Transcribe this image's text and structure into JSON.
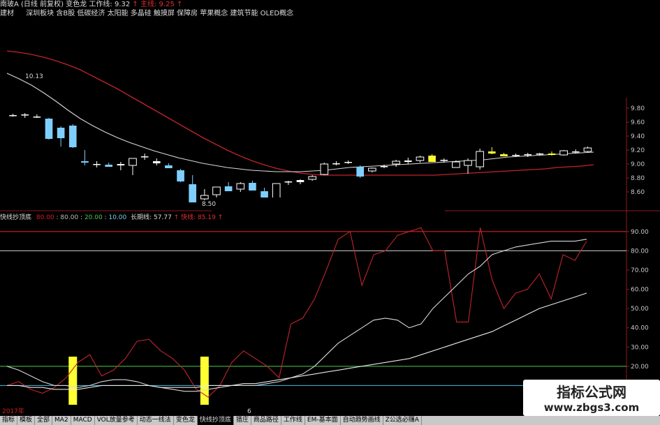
{
  "header": {
    "stock": "南玻A",
    "mode": "(日线 前复权)",
    "indicator": "变色龙",
    "work_line_label": "工作线:",
    "work_line_value": "9.32",
    "main_line_label": "主线:",
    "main_line_value": "9.25",
    "sector": "建材",
    "concepts": "深圳板块  含B股 低碳经济 太阳能 多晶硅 触摸屏 保障房 苹果概念 建筑节能 OLED概念"
  },
  "lower_header": {
    "name": "快线抄顶底",
    "ref_lines": [
      "80.00",
      "80.00",
      "20.00",
      "10.00"
    ],
    "long_label": "长期线:",
    "long_value": "57.77",
    "fast_label": "快线:",
    "fast_value": "85.19"
  },
  "annotations": {
    "high": "10.13",
    "low": "8.50"
  },
  "x_axis": {
    "labels": [
      "2017年",
      "6"
    ]
  },
  "colors": {
    "bg": "#000000",
    "up": "#ffffff",
    "down": "#7ecfff",
    "flat_yellow": "#ffff33",
    "ma_fast": "#d8d8d8",
    "ma_slow": "#c0242c",
    "red_line": "#d21f26",
    "grid": "#8c1a1a"
  },
  "chart_data": [
    {
      "type": "candlestick",
      "ylim": [
        8.5,
        9.9
      ],
      "y_ticks": [
        "9.80",
        "9.60",
        "9.40",
        "9.20",
        "9.00",
        "8.80",
        "8.60"
      ],
      "candles": [
        {
          "o": 9.7,
          "h": 9.72,
          "l": 9.68,
          "c": 9.7,
          "col": "up"
        },
        {
          "o": 9.7,
          "h": 9.73,
          "l": 9.66,
          "c": 9.71,
          "col": "up"
        },
        {
          "o": 9.68,
          "h": 9.71,
          "l": 9.66,
          "c": 9.68,
          "col": "up"
        },
        {
          "o": 9.65,
          "h": 9.66,
          "l": 9.35,
          "c": 9.36,
          "col": "down"
        },
        {
          "o": 9.52,
          "h": 9.54,
          "l": 9.25,
          "c": 9.37,
          "col": "down"
        },
        {
          "o": 9.55,
          "h": 9.57,
          "l": 9.23,
          "c": 9.24,
          "col": "down"
        },
        {
          "o": 9.04,
          "h": 9.2,
          "l": 8.98,
          "c": 9.02,
          "col": "down"
        },
        {
          "o": 9.0,
          "h": 9.04,
          "l": 8.95,
          "c": 8.99,
          "col": "up"
        },
        {
          "o": 8.99,
          "h": 9.02,
          "l": 8.96,
          "c": 8.96,
          "col": "down"
        },
        {
          "o": 8.98,
          "h": 9.03,
          "l": 8.91,
          "c": 9.0,
          "col": "up"
        },
        {
          "o": 8.98,
          "h": 9.06,
          "l": 8.84,
          "c": 9.08,
          "col": "up"
        },
        {
          "o": 9.11,
          "h": 9.15,
          "l": 9.06,
          "c": 9.1,
          "col": "up"
        },
        {
          "o": 9.01,
          "h": 9.08,
          "l": 8.98,
          "c": 9.04,
          "col": "up"
        },
        {
          "o": 8.98,
          "h": 9.01,
          "l": 8.94,
          "c": 8.94,
          "col": "down"
        },
        {
          "o": 8.91,
          "h": 8.93,
          "l": 8.74,
          "c": 8.75,
          "col": "down"
        },
        {
          "o": 8.71,
          "h": 8.84,
          "l": 8.68,
          "c": 8.45,
          "col": "down"
        },
        {
          "o": 8.5,
          "h": 8.64,
          "l": 8.48,
          "c": 8.55,
          "col": "up"
        },
        {
          "o": 8.56,
          "h": 8.66,
          "l": 8.5,
          "c": 8.67,
          "col": "up"
        },
        {
          "o": 8.68,
          "h": 8.74,
          "l": 8.63,
          "c": 8.61,
          "col": "down"
        },
        {
          "o": 8.64,
          "h": 8.74,
          "l": 8.6,
          "c": 8.72,
          "col": "up"
        },
        {
          "o": 8.73,
          "h": 8.76,
          "l": 8.62,
          "c": 8.62,
          "col": "down"
        },
        {
          "o": 8.61,
          "h": 8.66,
          "l": 8.4,
          "c": 8.4,
          "col": "down"
        },
        {
          "o": 8.39,
          "h": 8.72,
          "l": 8.36,
          "c": 8.72,
          "col": "up"
        },
        {
          "o": 8.74,
          "h": 8.76,
          "l": 8.7,
          "c": 8.75,
          "col": "up"
        },
        {
          "o": 8.74,
          "h": 8.78,
          "l": 8.71,
          "c": 8.77,
          "col": "up"
        },
        {
          "o": 8.78,
          "h": 8.84,
          "l": 8.76,
          "c": 8.82,
          "col": "up"
        },
        {
          "o": 8.85,
          "h": 9.02,
          "l": 8.84,
          "c": 9.0,
          "col": "up"
        },
        {
          "o": 9.0,
          "h": 9.04,
          "l": 8.98,
          "c": 9.01,
          "col": "up"
        },
        {
          "o": 9.02,
          "h": 9.05,
          "l": 9.0,
          "c": 9.03,
          "col": "up"
        },
        {
          "o": 8.96,
          "h": 8.98,
          "l": 8.8,
          "c": 8.82,
          "col": "down"
        },
        {
          "o": 8.9,
          "h": 8.95,
          "l": 8.88,
          "c": 8.94,
          "col": "up"
        },
        {
          "o": 8.96,
          "h": 8.99,
          "l": 8.94,
          "c": 8.97,
          "col": "up"
        },
        {
          "o": 9.0,
          "h": 9.06,
          "l": 8.96,
          "c": 9.04,
          "col": "up"
        },
        {
          "o": 9.03,
          "h": 9.09,
          "l": 9.0,
          "c": 9.05,
          "col": "up"
        },
        {
          "o": 9.05,
          "h": 9.12,
          "l": 9.02,
          "c": 9.1,
          "col": "up"
        },
        {
          "o": 9.12,
          "h": 9.14,
          "l": 9.03,
          "c": 9.03,
          "col": "flat_yellow"
        },
        {
          "o": 9.06,
          "h": 9.08,
          "l": 9.02,
          "c": 9.05,
          "col": "up"
        },
        {
          "o": 9.03,
          "h": 9.05,
          "l": 8.95,
          "c": 8.95,
          "col": "up"
        },
        {
          "o": 9.05,
          "h": 9.08,
          "l": 8.86,
          "c": 8.98,
          "col": "up"
        },
        {
          "o": 8.96,
          "h": 9.22,
          "l": 8.92,
          "c": 9.18,
          "col": "up"
        },
        {
          "o": 9.18,
          "h": 9.24,
          "l": 9.14,
          "c": 9.15,
          "col": "flat_yellow"
        },
        {
          "o": 9.14,
          "h": 9.16,
          "l": 9.11,
          "c": 9.11,
          "col": "flat_yellow"
        },
        {
          "o": 9.12,
          "h": 9.15,
          "l": 9.1,
          "c": 9.13,
          "col": "up"
        },
        {
          "o": 9.13,
          "h": 9.16,
          "l": 9.1,
          "c": 9.14,
          "col": "up"
        },
        {
          "o": 9.14,
          "h": 9.16,
          "l": 9.12,
          "c": 9.15,
          "col": "up"
        },
        {
          "o": 9.15,
          "h": 9.18,
          "l": 9.12,
          "c": 9.13,
          "col": "flat_yellow"
        },
        {
          "o": 9.13,
          "h": 9.2,
          "l": 9.12,
          "c": 9.19,
          "col": "up"
        },
        {
          "o": 9.17,
          "h": 9.21,
          "l": 9.15,
          "c": 9.18,
          "col": "up"
        },
        {
          "o": 9.18,
          "h": 9.25,
          "l": 9.16,
          "c": 9.23,
          "col": "up"
        }
      ],
      "ma_fast": [
        10.3,
        10.22,
        10.13,
        10.02,
        9.9,
        9.77,
        9.65,
        9.55,
        9.46,
        9.38,
        9.31,
        9.25,
        9.19,
        9.14,
        9.09,
        9.05,
        9.01,
        8.98,
        8.95,
        8.93,
        8.91,
        8.9,
        8.89,
        8.89,
        8.89,
        8.9,
        8.91,
        8.93,
        8.95,
        8.96,
        8.97,
        8.98,
        8.99,
        9.0,
        9.01,
        9.02,
        9.03,
        9.04,
        9.05,
        9.06,
        9.08,
        9.1,
        9.11,
        9.12,
        9.13,
        9.14,
        9.15,
        9.16,
        9.17
      ],
      "ma_slow": [
        10.62,
        10.6,
        10.57,
        10.53,
        10.48,
        10.42,
        10.35,
        10.26,
        10.17,
        10.08,
        9.98,
        9.88,
        9.78,
        9.68,
        9.58,
        9.48,
        9.38,
        9.29,
        9.2,
        9.12,
        9.05,
        8.99,
        8.94,
        8.9,
        8.87,
        8.85,
        8.84,
        8.84,
        8.84,
        8.84,
        8.84,
        8.84,
        8.84,
        8.84,
        8.84,
        8.84,
        8.85,
        8.86,
        8.87,
        8.88,
        8.89,
        8.9,
        8.91,
        8.92,
        8.93,
        8.95,
        8.96,
        8.97,
        8.99
      ]
    },
    {
      "type": "line",
      "ylim": [
        0,
        95
      ],
      "y_ticks": [
        "90.00",
        "80.00",
        "70.00",
        "60.00",
        "50.00",
        "40.00",
        "30.00",
        "20.00",
        "10.00"
      ],
      "hlines": [
        {
          "value": 90,
          "color": "#d21f26"
        },
        {
          "value": 80,
          "color": "#aaaaaa"
        },
        {
          "value": 20,
          "color": "#3ea33e"
        },
        {
          "value": 10,
          "color": "#3aa7c8"
        }
      ],
      "series": [
        {
          "color": "#c0242c",
          "values": [
            10,
            12,
            8,
            6,
            9,
            14,
            22,
            26,
            15,
            18,
            24,
            33,
            34,
            28,
            24,
            18,
            8,
            4,
            10,
            22,
            28,
            24,
            20,
            14,
            42,
            45,
            55,
            70,
            86,
            90,
            62,
            78,
            80,
            88,
            90,
            92,
            80,
            80,
            43,
            43,
            92,
            65,
            50,
            58,
            60,
            68,
            55,
            78,
            75,
            85
          ]
        },
        {
          "color": "#d8d8d8",
          "values": [
            20,
            18,
            15,
            12,
            10,
            10,
            9,
            10,
            12,
            13,
            13,
            12,
            10,
            9,
            8,
            7,
            7,
            8,
            9,
            10,
            10,
            10,
            11,
            12,
            14,
            16,
            20,
            26,
            32,
            36,
            40,
            44,
            45,
            44,
            40,
            42,
            50,
            56,
            62,
            68,
            72,
            78,
            80,
            82,
            83,
            84,
            85,
            85,
            85,
            86
          ]
        },
        {
          "color": "#e8e8e8",
          "values": [
            10,
            10,
            9,
            9,
            8,
            8,
            8,
            9,
            10,
            10,
            10,
            10,
            10,
            9,
            9,
            9,
            9,
            10,
            10,
            10,
            11,
            11,
            12,
            13,
            14,
            15,
            16,
            17,
            18,
            19,
            20,
            21,
            22,
            23,
            24,
            26,
            28,
            30,
            32,
            34,
            36,
            38,
            41,
            44,
            47,
            50,
            52,
            54,
            56,
            58
          ]
        }
      ],
      "bars": [
        {
          "index": 5,
          "value": 25,
          "color": "#ffff33"
        },
        {
          "index": 16,
          "value": 25,
          "color": "#ffff33"
        }
      ]
    }
  ],
  "toolbar": {
    "tabs": [
      "指标",
      "模板",
      "全部",
      "MA2",
      "MACD",
      "VOL放量参考",
      "动态一线法",
      "变色龙",
      "快线抄顶底",
      "猎庄",
      "商品路径",
      "工作线",
      "EM-基本面",
      "自动趋势画线",
      "Z公选必赚A"
    ],
    "active_index": 8
  },
  "watermark": {
    "line1": "指标公式网",
    "line2": "www.zbgs3.com"
  }
}
